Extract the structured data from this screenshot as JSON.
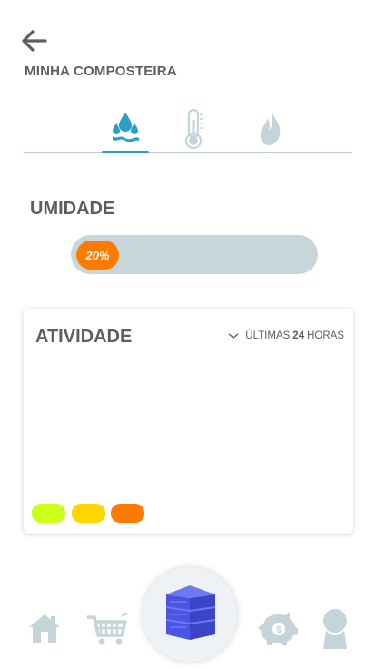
{
  "header": {
    "title": "MINHA COMPOSTEIRA"
  },
  "tabs": [
    {
      "name": "umidade",
      "icon": "water-drop-icon",
      "active": true
    },
    {
      "name": "temperatura",
      "icon": "thermometer-icon",
      "active": false
    },
    {
      "name": "gases",
      "icon": "flame-icon",
      "active": false
    }
  ],
  "humidity": {
    "title": "UMIDADE",
    "value_label": "20%",
    "value": 0.2
  },
  "activity": {
    "title": "ATIVIDADE",
    "period_prefix": "ÚLTIMAS",
    "period_number": "24",
    "period_suffix": "HORAS",
    "legend_colors": [
      "#cbff1a",
      "#ffd600",
      "#ff7a00"
    ]
  },
  "nav": {
    "items": [
      "home-icon",
      "cart-icon",
      "compost-bin-icon",
      "piggy-bank-icon",
      "profile-icon"
    ]
  },
  "colors": {
    "accent": "#2aa0c8",
    "orange": "#ff7a00",
    "icon_grey": "#c5d4d9",
    "bin_blue": "#4b55e3"
  }
}
